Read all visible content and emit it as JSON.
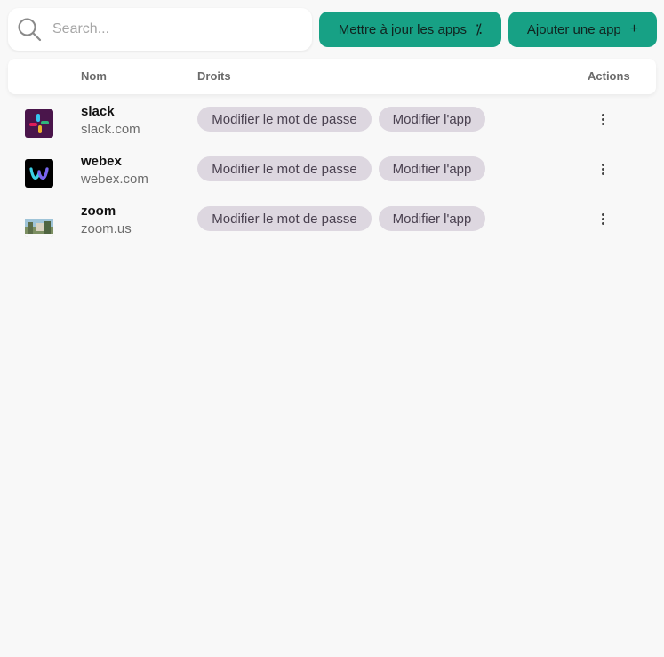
{
  "search": {
    "placeholder": "Search..."
  },
  "toolbar": {
    "update_label": "Mettre à jour les apps",
    "update_icon": "percent-sync-icon",
    "add_label": "Ajouter une app",
    "add_icon": "plus-icon"
  },
  "table": {
    "columns": [
      "Nom",
      "Droits",
      "Actions"
    ],
    "rows": [
      {
        "name": "slack",
        "domain": "slack.com",
        "icon": "slack-logo",
        "rights": [
          "Modifier le mot de passe",
          "Modifier l'app"
        ]
      },
      {
        "name": "webex",
        "domain": "webex.com",
        "icon": "webex-logo",
        "rights": [
          "Modifier le mot de passe",
          "Modifier l'app"
        ]
      },
      {
        "name": "zoom",
        "domain": "zoom.us",
        "icon": "zoom-logo",
        "rights": [
          "Modifier le mot de passe",
          "Modifier l'app"
        ]
      }
    ]
  },
  "colors": {
    "accent": "#17a185",
    "chip_bg": "#ddd7e0",
    "chip_text": "#4a4150",
    "background": "#f8f8f8"
  }
}
